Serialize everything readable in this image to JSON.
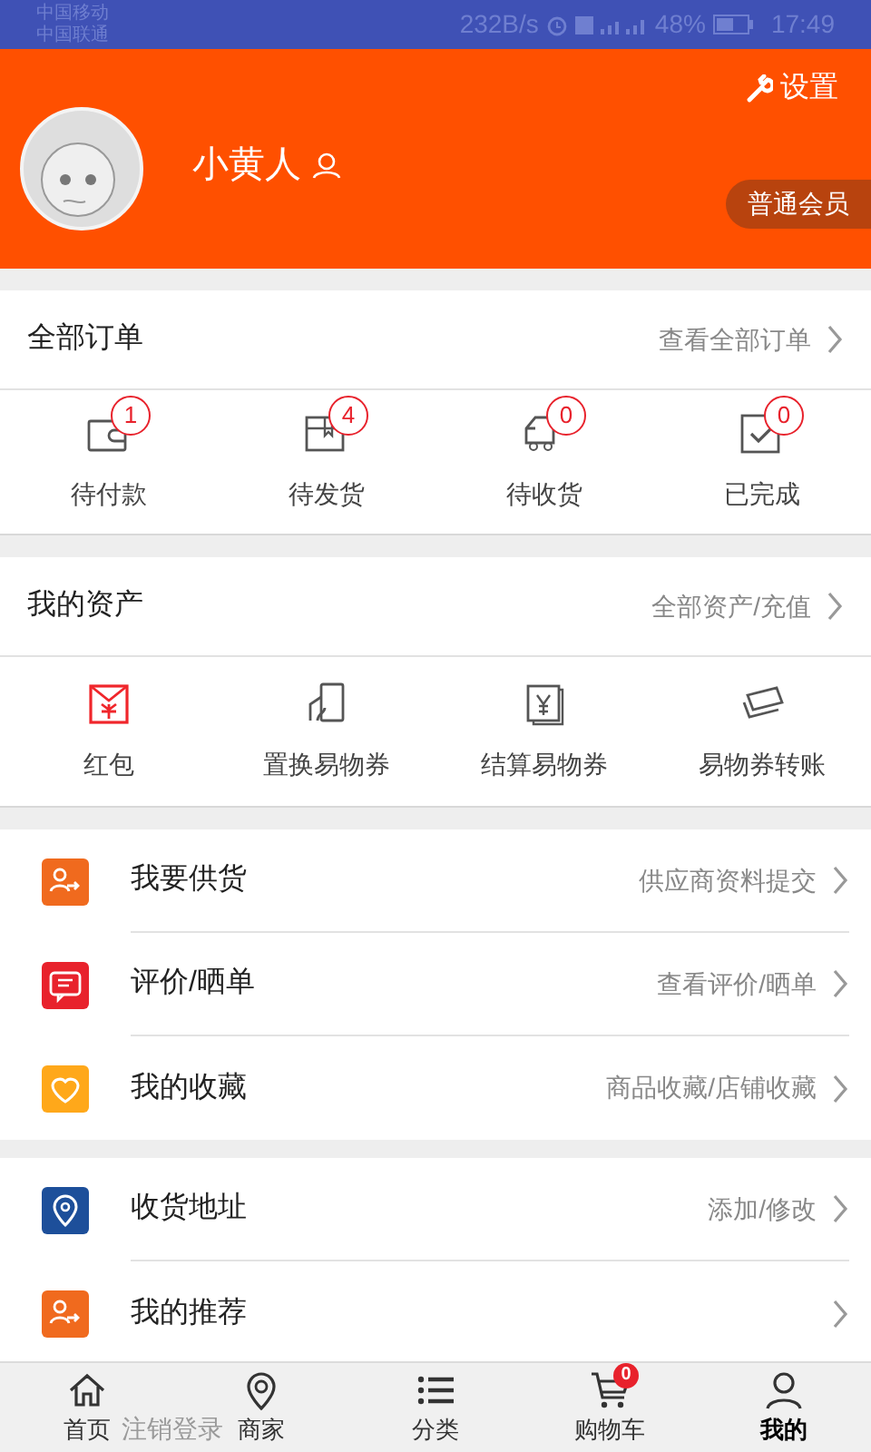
{
  "status_bar": {
    "carriers": [
      "中国移动",
      "中国联通"
    ],
    "speed": "232B/s",
    "battery": "48%",
    "time": "17:49"
  },
  "profile": {
    "settings": "设置",
    "name": "小黄人",
    "member_level": "普通会员"
  },
  "orders": {
    "title": "全部订单",
    "link": "查看全部订单",
    "items": [
      {
        "kind": "wallet",
        "label": "待付款",
        "count": "1"
      },
      {
        "kind": "box",
        "label": "待发货",
        "count": "4"
      },
      {
        "kind": "truck",
        "label": "待收货",
        "count": "0"
      },
      {
        "kind": "check",
        "label": "已完成",
        "count": "0"
      }
    ]
  },
  "assets": {
    "title": "我的资产",
    "link": "全部资产/充值",
    "items": [
      {
        "kind": "envelope",
        "label": "红包"
      },
      {
        "kind": "card",
        "label": "置换易物券"
      },
      {
        "kind": "yen",
        "label": "结算易物券"
      },
      {
        "kind": "bills",
        "label": "易物券转账"
      }
    ]
  },
  "menu_groups": [
    [
      {
        "kind": "supply",
        "label": "我要供货",
        "link": "供应商资料提交",
        "color": "#f06a1e"
      },
      {
        "kind": "comment",
        "label": "评价/晒单",
        "link": "查看评价/晒单",
        "color": "#e8222c"
      },
      {
        "kind": "heart",
        "label": "我的收藏",
        "link": "商品收藏/店铺收藏",
        "color": "#ffa81a"
      }
    ],
    [
      {
        "kind": "pin",
        "label": "收货地址",
        "link": "添加/修改",
        "color": "#1d4f9a"
      },
      {
        "kind": "supply",
        "label": "我的推荐",
        "color": "#f06a1e"
      }
    ]
  ],
  "logout": "注销登录",
  "tab_bar": [
    {
      "kind": "home",
      "label": "首页",
      "selected": false
    },
    {
      "kind": "pin",
      "label": "商家",
      "selected": false
    },
    {
      "kind": "list",
      "label": "分类",
      "selected": false
    },
    {
      "kind": "cart",
      "label": "购物车",
      "selected": false,
      "badge": "0"
    },
    {
      "kind": "user",
      "label": "我的",
      "selected": true
    }
  ]
}
